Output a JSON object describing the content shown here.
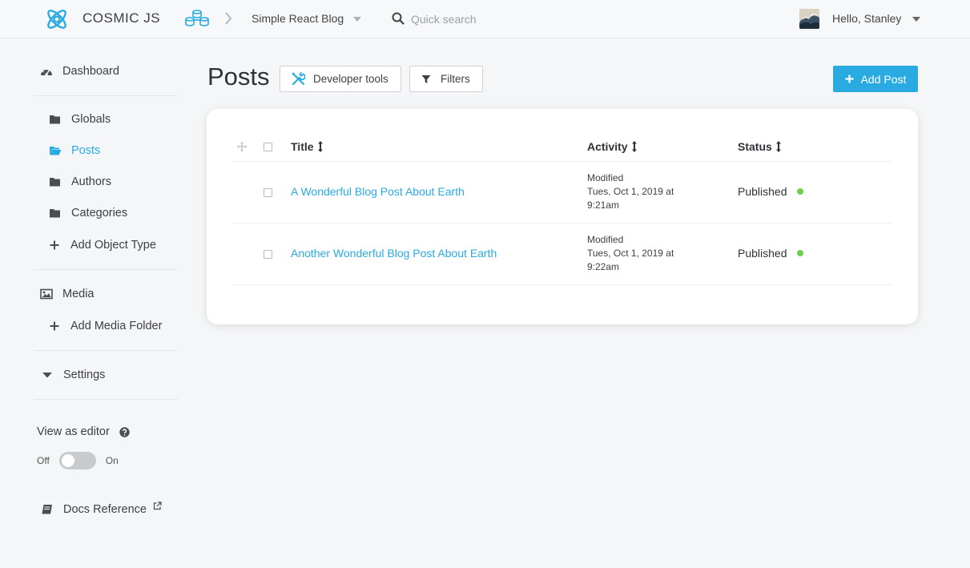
{
  "header": {
    "brand": "COSMIC JS",
    "bucket_name": "Simple React Blog",
    "search_placeholder": "Quick search",
    "greeting": "Hello, Stanley"
  },
  "sidebar": {
    "dashboard": "Dashboard",
    "object_types": [
      {
        "label": "Globals",
        "active": false
      },
      {
        "label": "Posts",
        "active": true
      },
      {
        "label": "Authors",
        "active": false
      },
      {
        "label": "Categories",
        "active": false
      }
    ],
    "add_object_type": "Add Object Type",
    "media": "Media",
    "add_media_folder": "Add Media Folder",
    "settings": "Settings",
    "view_as_editor": "View as editor",
    "toggle_off": "Off",
    "toggle_on": "On",
    "docs_reference": "Docs Reference"
  },
  "main": {
    "title": "Posts",
    "developer_tools": "Developer tools",
    "filters": "Filters",
    "add_post": "Add Post",
    "columns": {
      "title": "Title",
      "activity": "Activity",
      "status": "Status"
    },
    "rows": [
      {
        "title": "A Wonderful Blog Post About Earth",
        "activity_label": "Modified",
        "activity_date": "Tues, Oct 1, 2019 at",
        "activity_time": "9:21am",
        "status": "Published"
      },
      {
        "title": "Another Wonderful Blog Post About Earth",
        "activity_label": "Modified",
        "activity_date": "Tues, Oct 1, 2019 at",
        "activity_time": "9:22am",
        "status": "Published"
      }
    ]
  },
  "colors": {
    "accent": "#29abe2",
    "published": "#6fd14a"
  }
}
